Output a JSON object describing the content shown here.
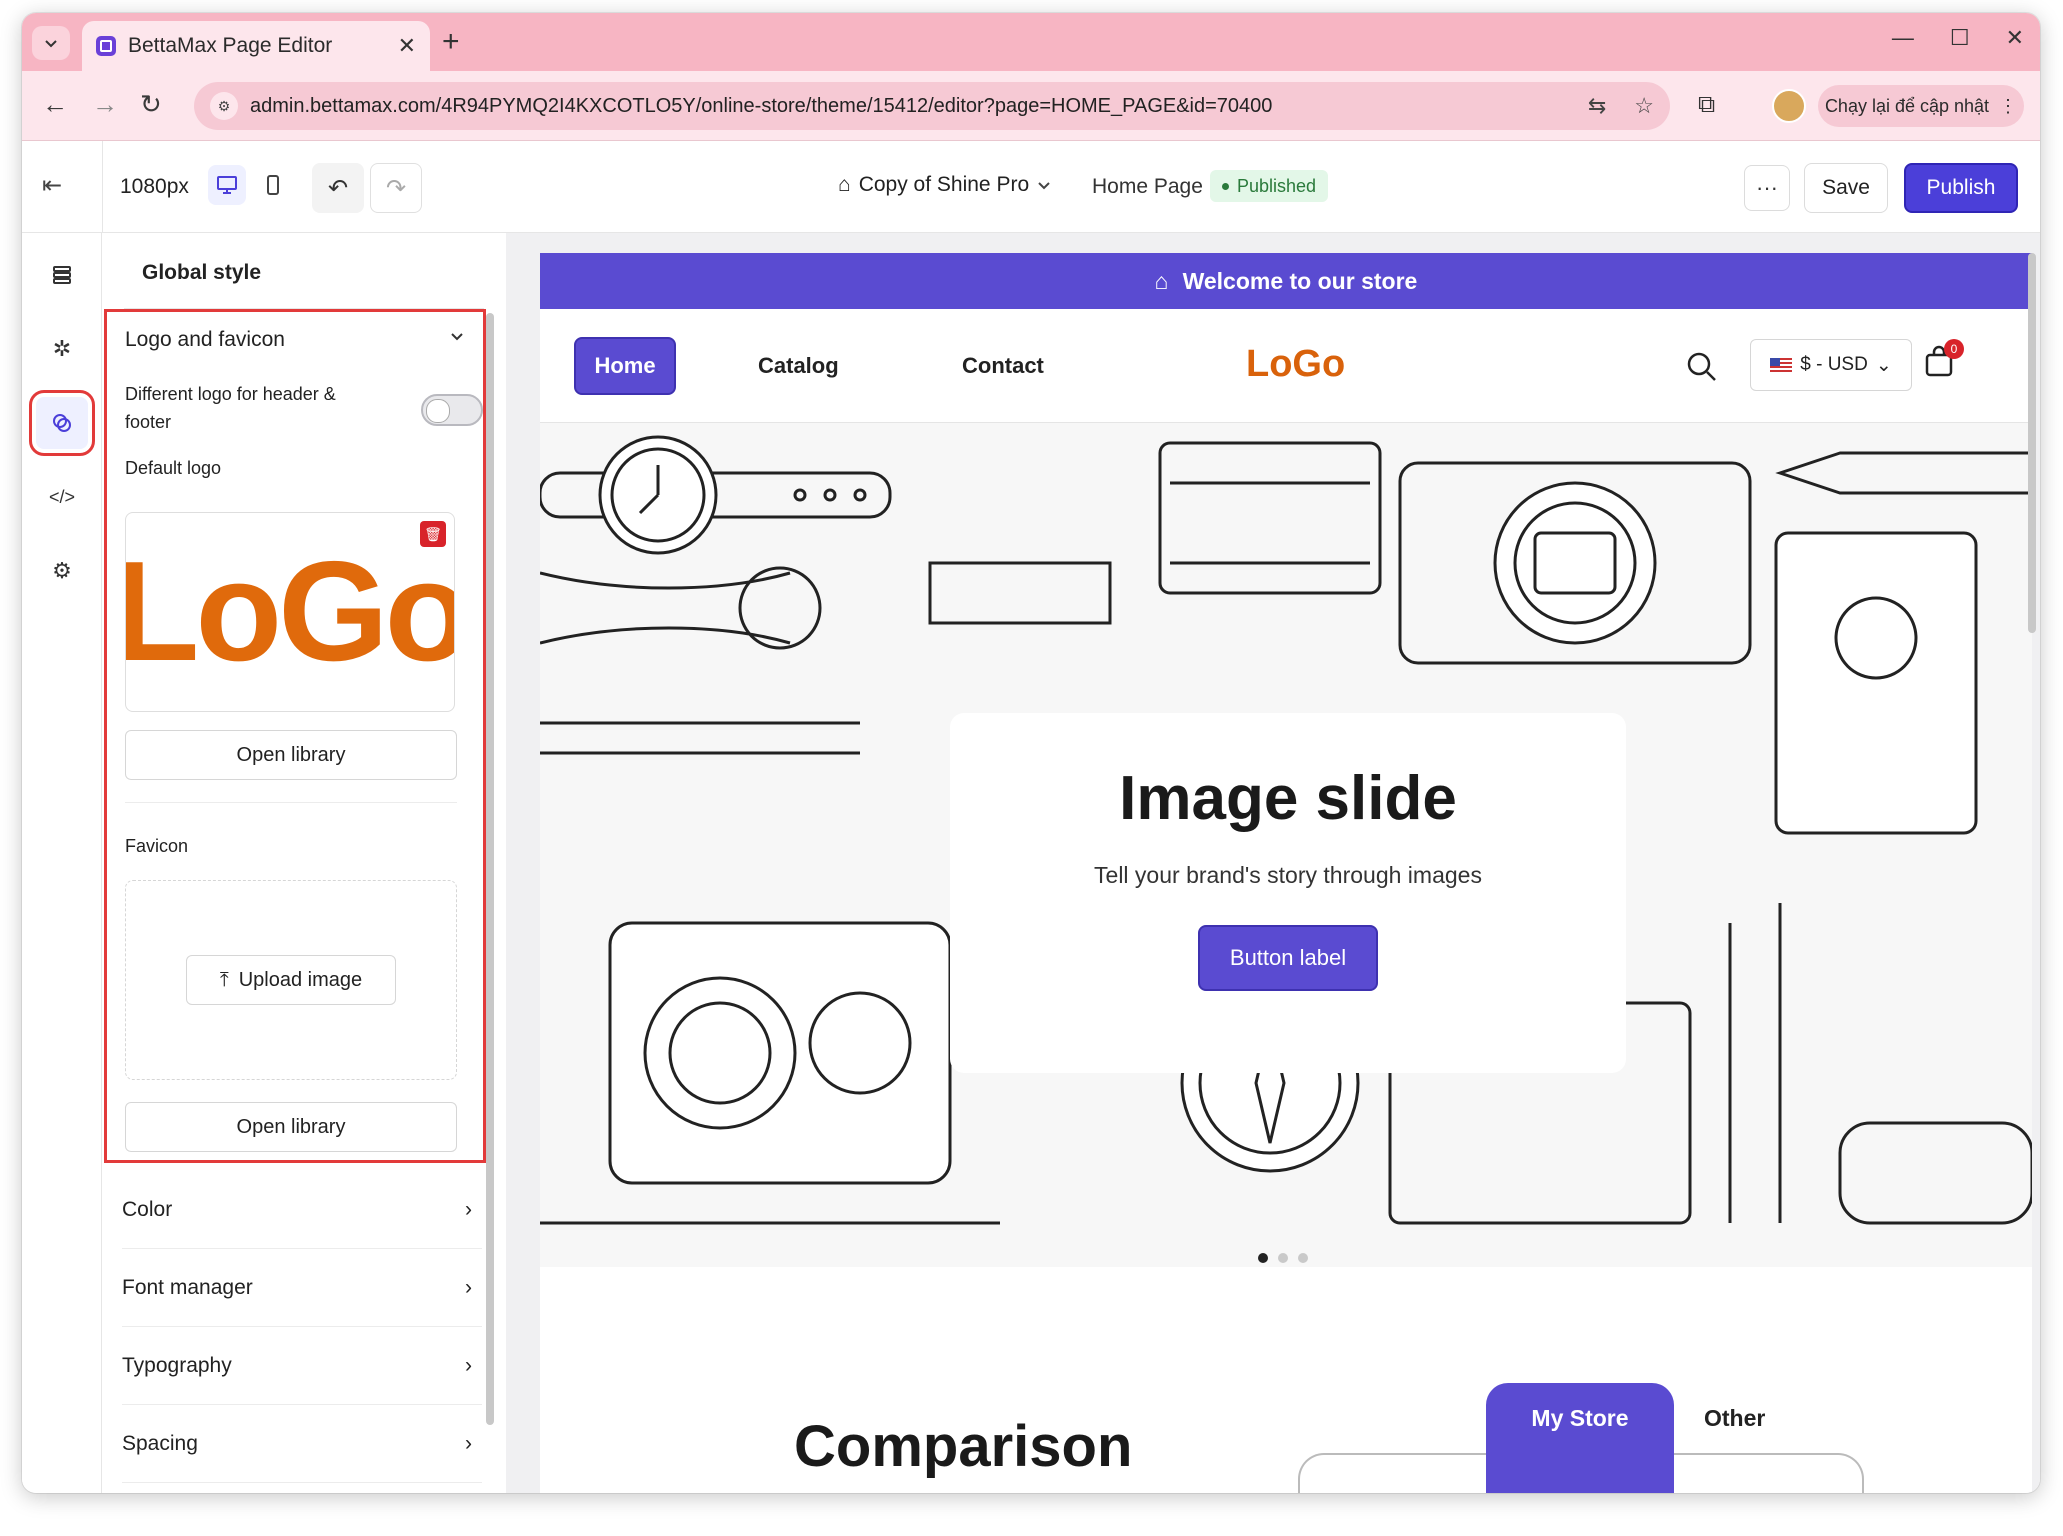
{
  "browser": {
    "tab_title": "BettaMax Page Editor",
    "url": "admin.bettamax.com/4R94PYMQ2I4KXCOTLO5Y/online-store/theme/15412/editor?page=HOME_PAGE&id=70400",
    "update_button": "Chạy lại để cập nhật"
  },
  "editor": {
    "width_label": "1080px",
    "theme_name": "Copy of Shine Pro",
    "page_name": "Home Page",
    "status": "Published",
    "more_label": "···",
    "save_label": "Save",
    "publish_label": "Publish"
  },
  "panel": {
    "title": "Global style",
    "logo_section": {
      "title": "Logo and favicon",
      "toggle_label": "Different logo for header & footer",
      "toggle_on": false,
      "default_logo_label": "Default logo",
      "logo_text": "LoGo",
      "open_library_label": "Open library",
      "favicon_label": "Favicon",
      "upload_label": "Upload image",
      "open_library_label_2": "Open library"
    },
    "accordions": [
      "Color",
      "Font manager",
      "Typography",
      "Spacing"
    ]
  },
  "store": {
    "announcement": "Welcome to our store",
    "nav": [
      "Home",
      "Catalog",
      "Contact"
    ],
    "logo": "LoGo",
    "currency": "$ - USD",
    "cart_count": "0",
    "hero": {
      "title": "Image slide",
      "subtitle": "Tell your brand's story through images",
      "button": "Button label",
      "slide_count": 3,
      "active_slide": 1
    },
    "comparison_title": "Comparison",
    "comparison_tabs": [
      "My Store",
      "Other"
    ]
  },
  "colors": {
    "accent": "#5a4bd1",
    "publish": "#4b3fd9",
    "logo_orange": "#e06a0c",
    "highlight_red": "#e23a3a",
    "browser_chrome": "#f7b5c3"
  }
}
